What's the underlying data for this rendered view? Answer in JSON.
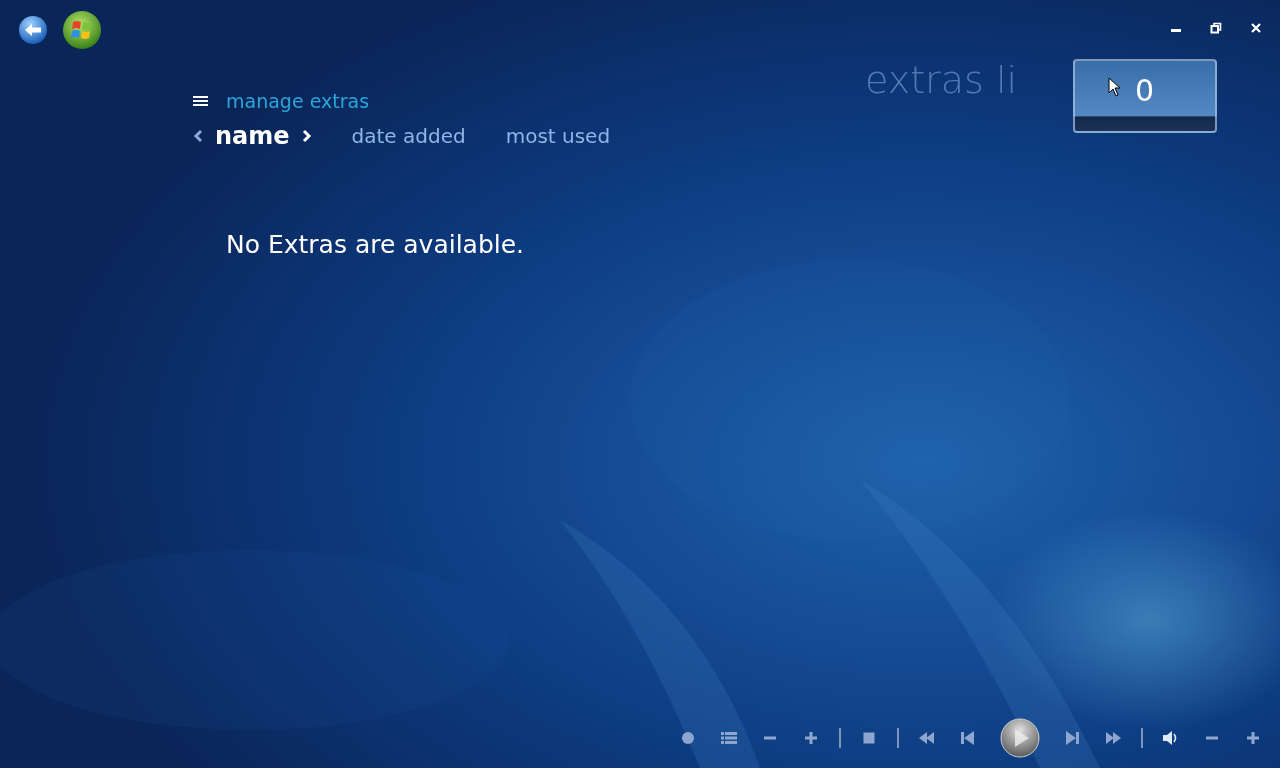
{
  "page_title": "extras li",
  "counter": "0",
  "menu": {
    "label": "manage extras"
  },
  "sort_options": [
    {
      "label": "name",
      "selected": true
    },
    {
      "label": "date added",
      "selected": false
    },
    {
      "label": "most used",
      "selected": false
    }
  ],
  "message": "No Extras are available."
}
